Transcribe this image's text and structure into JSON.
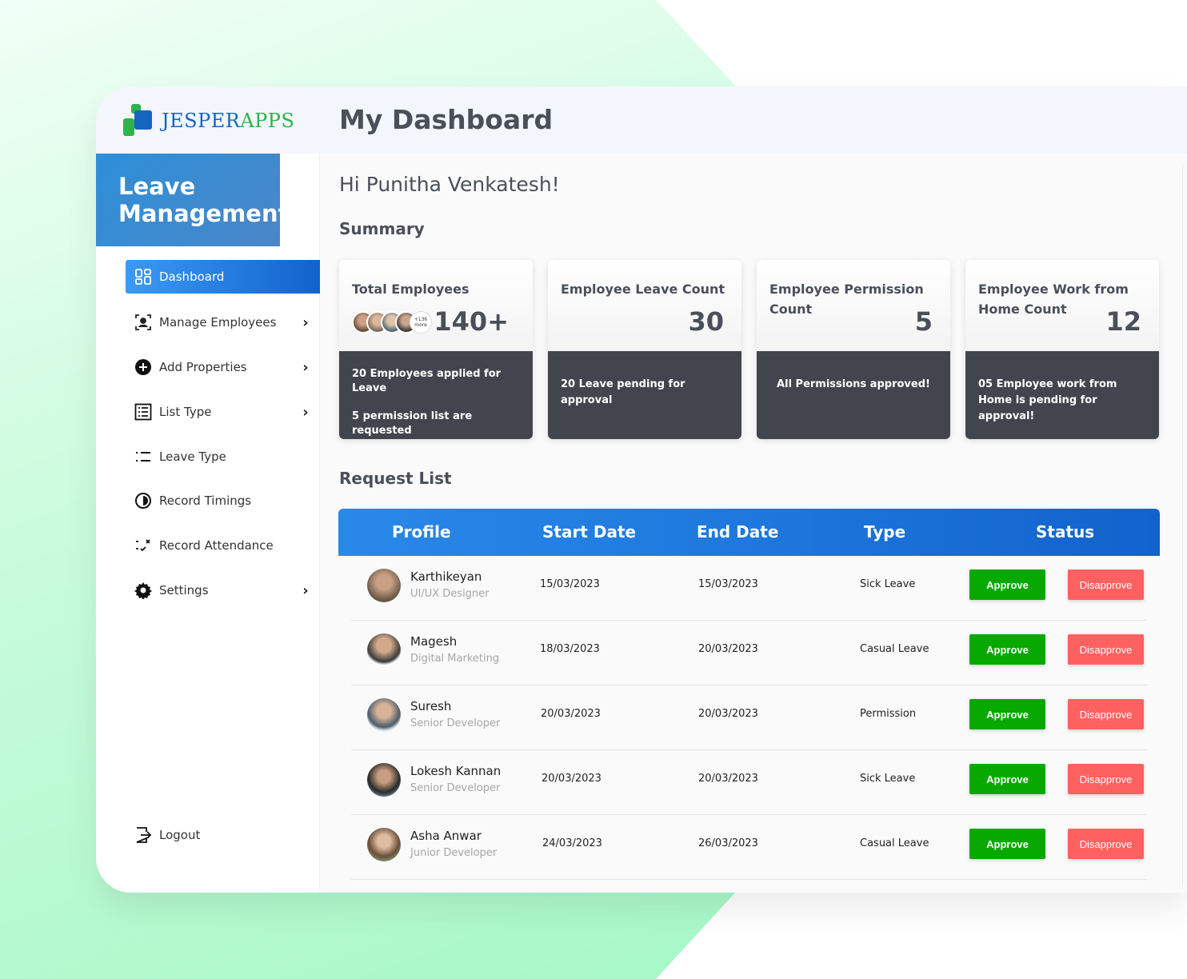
{
  "brand": {
    "name_a": "JESPER",
    "name_b": "APPS"
  },
  "header": {
    "title": "My Dashboard"
  },
  "sidebar": {
    "heading": "Leave Management",
    "items": [
      {
        "label": "Dashboard",
        "icon": "dashboard-icon",
        "active": true
      },
      {
        "label": "Manage Employees",
        "icon": "people-icon",
        "chevron": true
      },
      {
        "label": "Add Properties",
        "icon": "add-circle-icon",
        "chevron": true
      },
      {
        "label": "List Type",
        "icon": "list-box-icon",
        "chevron": true
      },
      {
        "label": "Leave Type",
        "icon": "list-icon"
      },
      {
        "label": "Record Timings",
        "icon": "clock-icon"
      },
      {
        "label": "Record Attendance",
        "icon": "attendance-icon"
      },
      {
        "label": "Settings",
        "icon": "gear-icon",
        "chevron": true
      }
    ],
    "logout": "Logout"
  },
  "main": {
    "greeting": "Hi Punitha Venkatesh!",
    "summary_heading": "Summary",
    "cards": [
      {
        "title": "Total Employees",
        "value": "140+",
        "line1": "20 Employees applied for Leave",
        "line2": "5 permission list are requested",
        "avatars_more": "+136 more"
      },
      {
        "title": "Employee Leave Count",
        "value": "30",
        "line1": "20 Leave pending for approval"
      },
      {
        "title": "Employee Permission Count",
        "value": "5",
        "line1": "All Permissions approved!"
      },
      {
        "title": "Employee Work from Home Count",
        "value": "12",
        "line1": "05 Employee work from Home is pending for approval!"
      }
    ],
    "request_heading": "Request List",
    "table": {
      "columns": [
        "Profile",
        "Start Date",
        "End Date",
        "Type",
        "Status"
      ],
      "approve_label": "Approve",
      "disapprove_label": "Disapprove",
      "rows": [
        {
          "name": "Karthikeyan",
          "role": "UI/UX Designer",
          "start": "15/03/2023",
          "end": "15/03/2023",
          "type": "Sick Leave"
        },
        {
          "name": "Magesh",
          "role": "Digital Marketing",
          "start": "18/03/2023",
          "end": "20/03/2023",
          "type": "Casual Leave"
        },
        {
          "name": "Suresh",
          "role": "Senior Developer",
          "start": "20/03/2023",
          "end": "20/03/2023",
          "type": "Permission"
        },
        {
          "name": "Lokesh Kannan",
          "role": "Senior Developer",
          "start": "20/03/2023",
          "end": "20/03/2023",
          "type": "Sick Leave"
        },
        {
          "name": "Asha Anwar",
          "role": "Junior Developer",
          "start": "24/03/2023",
          "end": "26/03/2023",
          "type": "Casual Leave"
        }
      ]
    }
  },
  "colors": {
    "primary": "#1e78dd",
    "approve": "#07a900",
    "disapprove": "#ff6161",
    "card_dark": "#42454d"
  }
}
